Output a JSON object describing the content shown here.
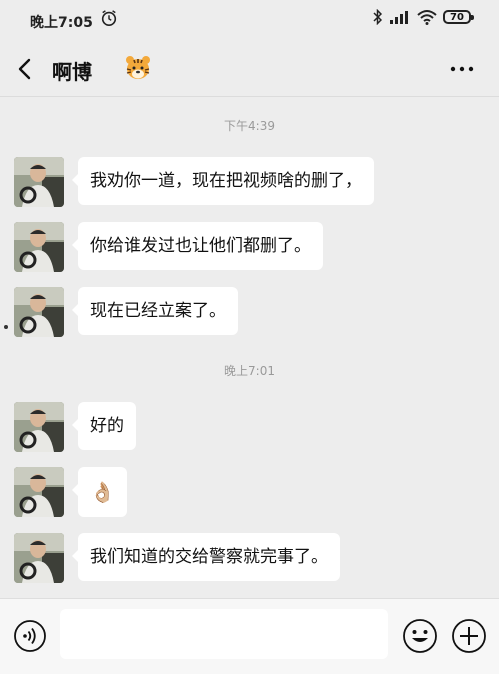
{
  "status_bar": {
    "time": "晚上7:05",
    "battery": "70"
  },
  "header": {
    "title": "啊博",
    "tiger_emoji": "🐯"
  },
  "messages": [
    {
      "type": "time",
      "text": "下午4:39"
    },
    {
      "type": "incoming",
      "sender": "啊博",
      "text": "我劝你一道，现在把视频啥的删了，"
    },
    {
      "type": "incoming",
      "sender": "啊博",
      "text": "你给谁发过也让他们都删了。"
    },
    {
      "type": "incoming",
      "sender": "啊博",
      "text": "现在已经立案了。"
    },
    {
      "type": "time",
      "text": "晚上7:01"
    },
    {
      "type": "incoming",
      "sender": "啊博",
      "text": "好的"
    },
    {
      "type": "incoming",
      "sender": "啊博",
      "text": "👌🏼"
    },
    {
      "type": "incoming",
      "sender": "啊博",
      "text": "我们知道的交给警察就完事了。"
    }
  ],
  "input_bar": {
    "value": "",
    "placeholder": ""
  },
  "icons": {
    "back": "chevron-left-icon",
    "more": "more-dots-icon",
    "voice": "voice-icon",
    "emoji": "smiley-icon",
    "plus": "plus-icon",
    "alarm": "alarm-icon",
    "bluetooth": "bluetooth-icon",
    "signal": "signal-icon",
    "wifi": "wifi-icon"
  },
  "colors": {
    "background": "#ededed",
    "bubble": "#ffffff",
    "timestamp": "#9a9a9a"
  }
}
